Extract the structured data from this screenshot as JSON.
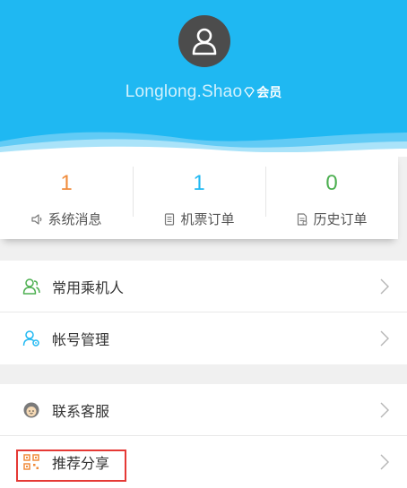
{
  "profile": {
    "username": "Longlong.Shao",
    "member_label": "会员"
  },
  "stats": [
    {
      "value": "1",
      "label": "系统消息",
      "icon": "speaker-icon",
      "color": "#f08c3c"
    },
    {
      "value": "1",
      "label": "机票订单",
      "icon": "ticket-icon",
      "color": "#1fb8f2"
    },
    {
      "value": "0",
      "label": "历史订单",
      "icon": "history-icon",
      "color": "#4caf50"
    }
  ],
  "menu": {
    "passengers": {
      "label": "常用乘机人",
      "icon": "passenger-icon"
    },
    "account": {
      "label": "帐号管理",
      "icon": "account-settings-icon"
    },
    "service": {
      "label": "联系客服",
      "icon": "customer-service-icon"
    },
    "share": {
      "label": "推荐分享",
      "icon": "qr-code-icon"
    }
  },
  "colors": {
    "header_bg": "#1fb8f2",
    "highlight": "#e53935"
  }
}
